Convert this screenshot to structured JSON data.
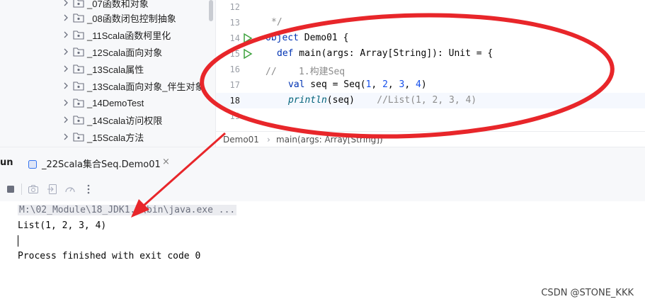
{
  "tree": {
    "items": [
      {
        "label": "_07函数和对象"
      },
      {
        "label": "_08函数闭包控制抽象"
      },
      {
        "label": "_11Scala函数柯里化"
      },
      {
        "label": "_12Scala面向对象"
      },
      {
        "label": "_13Scala属性"
      },
      {
        "label": "_13Scala面向对象_伴生对象"
      },
      {
        "label": "_14DemoTest"
      },
      {
        "label": "_14Scala访问权限"
      },
      {
        "label": "_15Scala方法"
      }
    ]
  },
  "editor": {
    "line_numbers": [
      "12",
      "13",
      "14",
      "15",
      "16",
      "17",
      "18",
      "19"
    ],
    "line13": "*/",
    "line14": {
      "kw": "object",
      "rest": " Demo01 {"
    },
    "line15": {
      "kw1": "def",
      "name": " main(args: Array[String]): Unit = {"
    },
    "line16": "//    1.构建Seq",
    "line17": {
      "kw": "val",
      "a": " seq = Seq(",
      "n1": "1",
      "c1": ", ",
      "n2": "2",
      "c2": ", ",
      "n3": "3",
      "c3": ", ",
      "n4": "4",
      "end": ")"
    },
    "line18": {
      "fn": "println",
      "args": "(seq)",
      "cmt": "    //List(1, 2, 3, 4)"
    }
  },
  "breadcrumb": {
    "items": [
      "Demo01",
      "main(args: Array[String])"
    ],
    "sep": "›"
  },
  "run_window": {
    "title": "un",
    "tab_label": "_22Scala集合Seq.Demo01",
    "tab_close": "×"
  },
  "console": {
    "command": "M:\\02_Module\\18_JDK1.8\\bin\\java.exe ...",
    "output": "List(1, 2, 3, 4)",
    "finished": "Process finished with exit code 0"
  },
  "watermark": "CSDN @STONE_KKK",
  "colors": {
    "accent": "#3574f0",
    "annotation": "#e8262a",
    "run_green": "#3fa33f"
  }
}
